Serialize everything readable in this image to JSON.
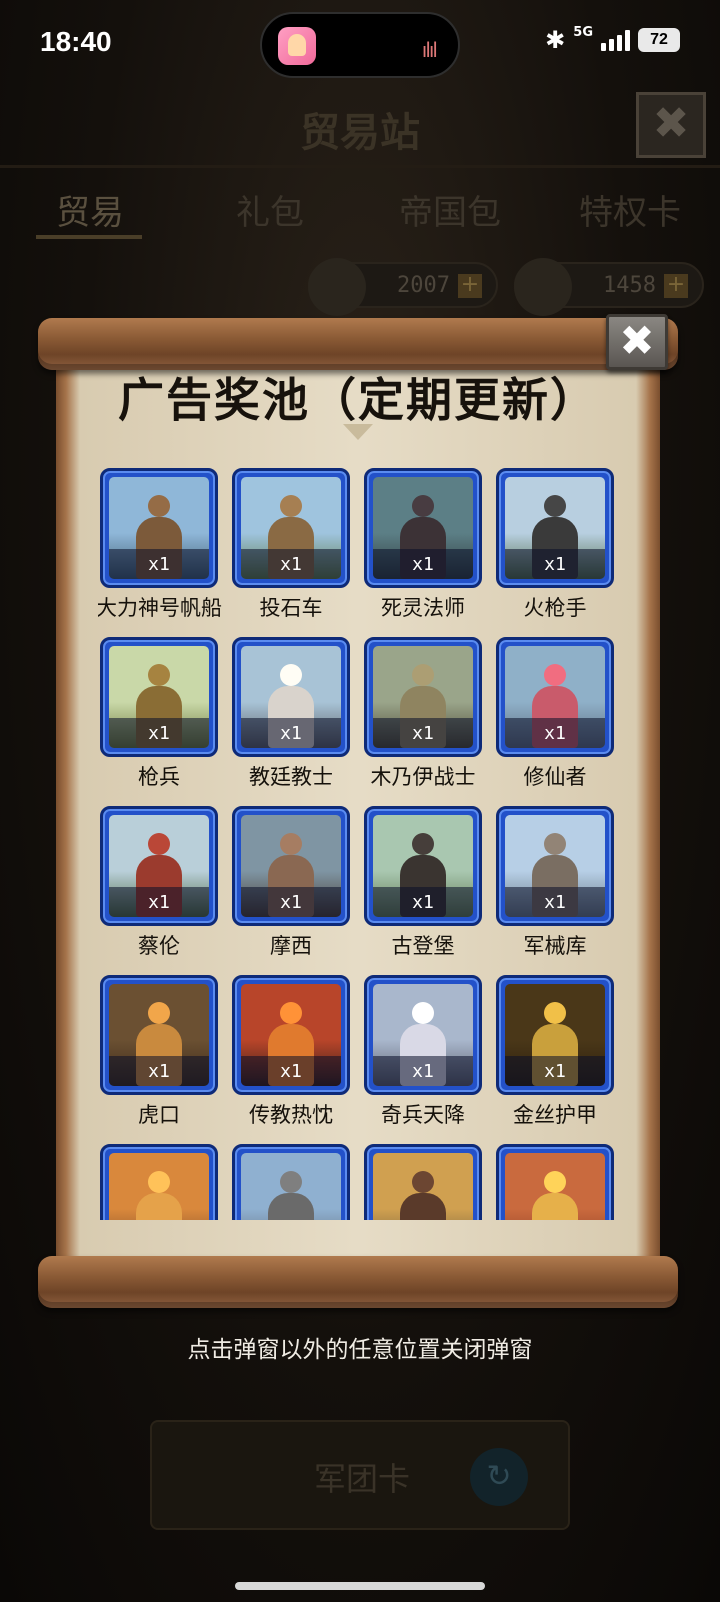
{
  "status_bar": {
    "time": "18:40",
    "network": "5G",
    "battery": "72"
  },
  "header": {
    "title": "贸易站",
    "close_label": "✖"
  },
  "tabs": [
    {
      "label": "贸易",
      "active": true
    },
    {
      "label": "礼包",
      "active": false
    },
    {
      "label": "帝国包",
      "active": false
    },
    {
      "label": "特权卡",
      "active": false
    }
  ],
  "currencies": [
    {
      "icon": "laurel-medal-icon",
      "value": "2007",
      "plus": "+"
    },
    {
      "icon": "diamond-icon",
      "value": "1458",
      "plus": "+"
    }
  ],
  "popup": {
    "title": "广告奖池（定期更新）",
    "close_label": "✖",
    "items": [
      {
        "name": "大力神号帆船",
        "qty": "x1",
        "sky": "#8fb7d8",
        "ground": "#3f5d73",
        "fig": "#7c5a3a"
      },
      {
        "name": "投石车",
        "qty": "x1",
        "sky": "#9fc4de",
        "ground": "#5d7a4a",
        "fig": "#8a6a44"
      },
      {
        "name": "死灵法师",
        "qty": "x1",
        "sky": "#5c7f86",
        "ground": "#2f3d40",
        "fig": "#3c3236"
      },
      {
        "name": "火枪手",
        "qty": "x1",
        "sky": "#b8cfe0",
        "ground": "#4f6b4a",
        "fig": "#3a3a3a"
      },
      {
        "name": "枪兵",
        "qty": "x1",
        "sky": "#c9d8a8",
        "ground": "#6b7a3c",
        "fig": "#8a6d35"
      },
      {
        "name": "教廷教士",
        "qty": "x1",
        "sky": "#a8c3d6",
        "ground": "#5b5f66",
        "fig": "#d9d3cc"
      },
      {
        "name": "木乃伊战士",
        "qty": "x1",
        "sky": "#9aa58a",
        "ground": "#4d4a35",
        "fig": "#8f8460"
      },
      {
        "name": "修仙者",
        "qty": "x1",
        "sky": "#8fb0c8",
        "ground": "#5d6b7e",
        "fig": "#c95b6b"
      },
      {
        "name": "蔡伦",
        "qty": "x1",
        "sky": "#b9cfd9",
        "ground": "#4f6a45",
        "fig": "#9b3b2e"
      },
      {
        "name": "摩西",
        "qty": "x1",
        "sky": "#7f95a3",
        "ground": "#4a3f36",
        "fig": "#8a6852"
      },
      {
        "name": "古登堡",
        "qty": "x1",
        "sky": "#a9c7b0",
        "ground": "#5f7a52",
        "fig": "#3a3430"
      },
      {
        "name": "军械库",
        "qty": "x1",
        "sky": "#b7cfe6",
        "ground": "#667785",
        "fig": "#7a6e62"
      },
      {
        "name": "虎口",
        "qty": "x1",
        "sky": "#6b5032",
        "ground": "#3b2a1a",
        "fig": "#c98a3e"
      },
      {
        "name": "传教热忱",
        "qty": "x1",
        "sky": "#b8452a",
        "ground": "#3a1f18",
        "fig": "#e07a2e"
      },
      {
        "name": "奇兵天降",
        "qty": "x1",
        "sky": "#a9b7cc",
        "ground": "#5b5f6e",
        "fig": "#d9d9e6"
      },
      {
        "name": "金丝护甲",
        "qty": "x1",
        "sky": "#4a3718",
        "ground": "#2b1f0e",
        "fig": "#c9a03c"
      },
      {
        "name": "",
        "qty": "",
        "sky": "#d9883c",
        "ground": "#7a4a26",
        "fig": "#e5a24a"
      },
      {
        "name": "",
        "qty": "",
        "sky": "#8fb0d0",
        "ground": "#5d6a78",
        "fig": "#6a6a6a"
      },
      {
        "name": "",
        "qty": "",
        "sky": "#d0a050",
        "ground": "#6a5a3a",
        "fig": "#5a3a2a"
      },
      {
        "name": "",
        "qty": "",
        "sky": "#c96a3e",
        "ground": "#8a3a22",
        "fig": "#e6b04a"
      }
    ]
  },
  "hint": "点击弹窗以外的任意位置关闭弹窗",
  "bottom_banner": {
    "label": "军团卡",
    "refresh": "↻"
  }
}
